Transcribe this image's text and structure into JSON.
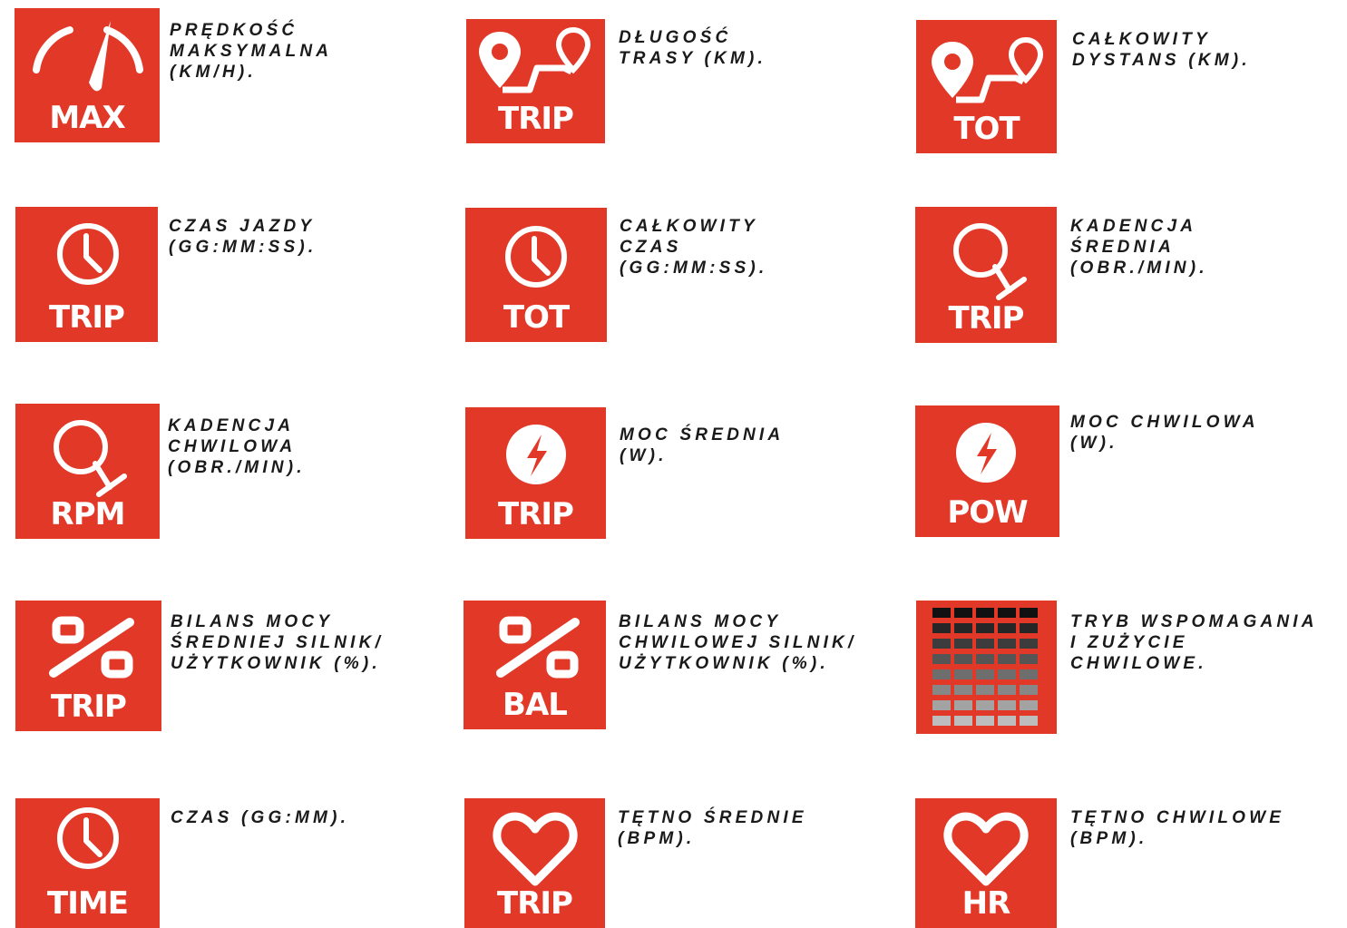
{
  "accent": "#e23828",
  "items": [
    {
      "icon": "speedometer-icon",
      "label": "MAX",
      "text": "PRĘDKOŚĆ\nMAKSYMALNA\n(KM/H)."
    },
    {
      "icon": "route-icon",
      "label": "TRIP",
      "text": "DŁUGOŚĆ\nTRASY (KM)."
    },
    {
      "icon": "route-icon",
      "label": "TOT",
      "text": "CAŁKOWITY\nDYSTANS (KM)."
    },
    {
      "icon": "clock-icon",
      "label": "TRIP",
      "text": "CZAS JAZDY\n(GG:MM:SS)."
    },
    {
      "icon": "clock-icon",
      "label": "TOT",
      "text": "CAŁKOWITY\nCZAS\n(GG:MM:SS)."
    },
    {
      "icon": "cadence-icon",
      "label": "TRIP",
      "text": "KADENCJA\nŚREDNIA\n(OBR./MIN)."
    },
    {
      "icon": "cadence-icon",
      "label": "RPM",
      "text": "KADENCJA\nCHWILOWA\n(OBR./MIN)."
    },
    {
      "icon": "power-icon",
      "label": "TRIP",
      "text": "MOC ŚREDNIA\n(W)."
    },
    {
      "icon": "power-icon",
      "label": "POW",
      "text": "MOC CHWILOWA\n(W)."
    },
    {
      "icon": "percent-icon",
      "label": "TRIP",
      "text": "BILANS MOCY\nŚREDNIEJ SILNIK/\nUŻYTKOWNIK (%)."
    },
    {
      "icon": "percent-icon",
      "label": "BAL",
      "text": "BILANS MOCY\nCHWILOWEJ SILNIK/\nUŻYTKOWNIK (%)."
    },
    {
      "icon": "assist-level-bars-icon",
      "label": "",
      "text": "TRYB WSPOMAGANIA\nI ZUŻYCIE\nCHWILOWE."
    },
    {
      "icon": "clock-icon",
      "label": "TIME",
      "text": "CZAS (GG:MM)."
    },
    {
      "icon": "heart-icon",
      "label": "TRIP",
      "text": "TĘTNO ŚREDNIE\n(BPM)."
    },
    {
      "icon": "heart-icon",
      "label": "HR",
      "text": "TĘTNO CHWILOWE\n(BPM)."
    }
  ]
}
